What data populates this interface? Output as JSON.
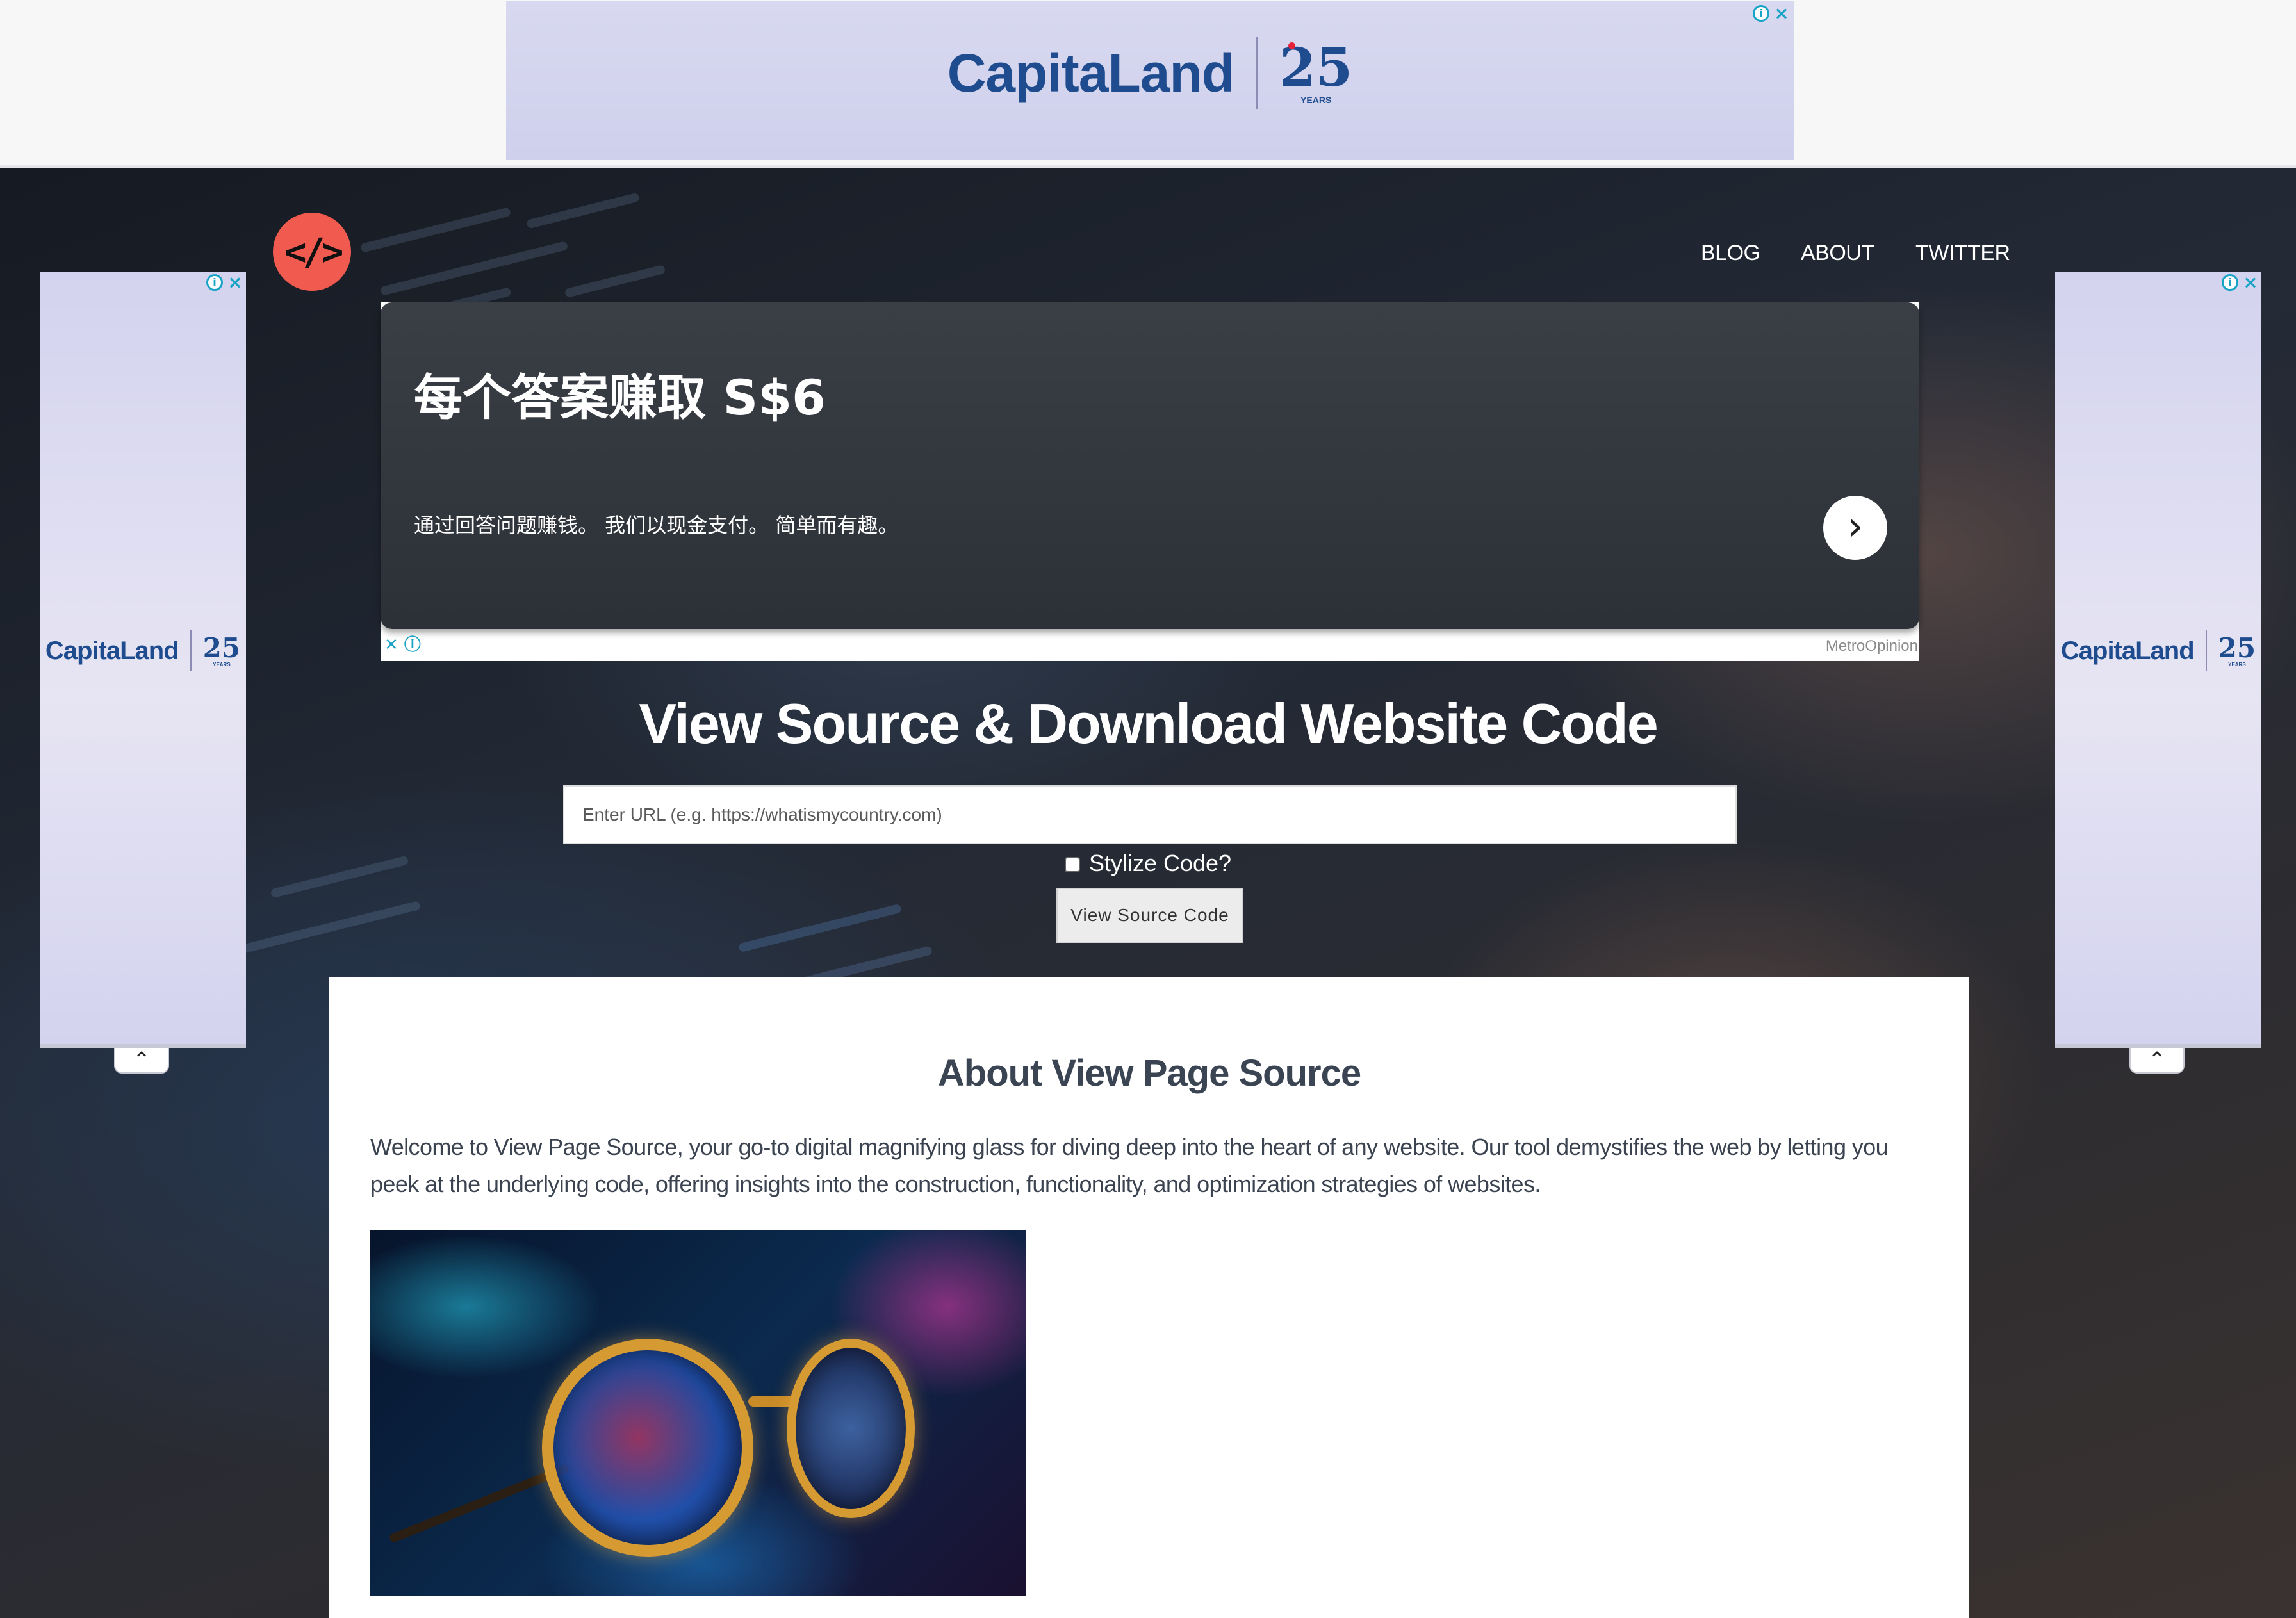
{
  "ads": {
    "top_banner": {
      "brand": "CapitaLand",
      "anniversary": "25",
      "anniversary_caption": "YEARS",
      "info_icon": "info-icon",
      "close_icon": "close-icon"
    },
    "left_skyscraper": {
      "brand": "CapitaLand",
      "anniversary": "25",
      "anniversary_caption": "YEARS",
      "collapse_icon": "chevron-up-icon"
    },
    "right_skyscraper": {
      "brand": "CapitaLand",
      "anniversary": "25",
      "anniversary_caption": "YEARS",
      "collapse_icon": "chevron-up-icon"
    },
    "native": {
      "headline": "每个答案赚取 S$6",
      "body": "通过回答问题赚钱。 我们以现金支付。 简单而有趣。",
      "cta_icon": "chevron-right-icon",
      "sponsor": "MetroOpinion"
    }
  },
  "site": {
    "logo_text": "</>",
    "nav": [
      "BLOG",
      "ABOUT",
      "TWITTER"
    ]
  },
  "hero": {
    "title": "View Source & Download Website Code",
    "url_placeholder": "Enter URL (e.g. https://whatismycountry.com)",
    "url_value": "",
    "stylize_label": "Stylize Code?",
    "stylize_checked": false,
    "submit_label": "View Source Code"
  },
  "about": {
    "heading": "About View Page Source",
    "body": "Welcome to View Page Source, your go-to digital magnifying glass for diving deep into the heart of any website. Our tool demystifies the web by letting you peek at the underlying code, offering insights into the construction, functionality, and optimization strategies of websites.",
    "image": "glasses-over-code-image"
  },
  "colors": {
    "logo_bg": "#f05a4f",
    "ad_bg": "#d3d3ef",
    "ad_brand": "#1f4c8f",
    "ad_swoosh": "#2aa84a",
    "native_card": "#33373e",
    "about_text": "#3b4350"
  }
}
